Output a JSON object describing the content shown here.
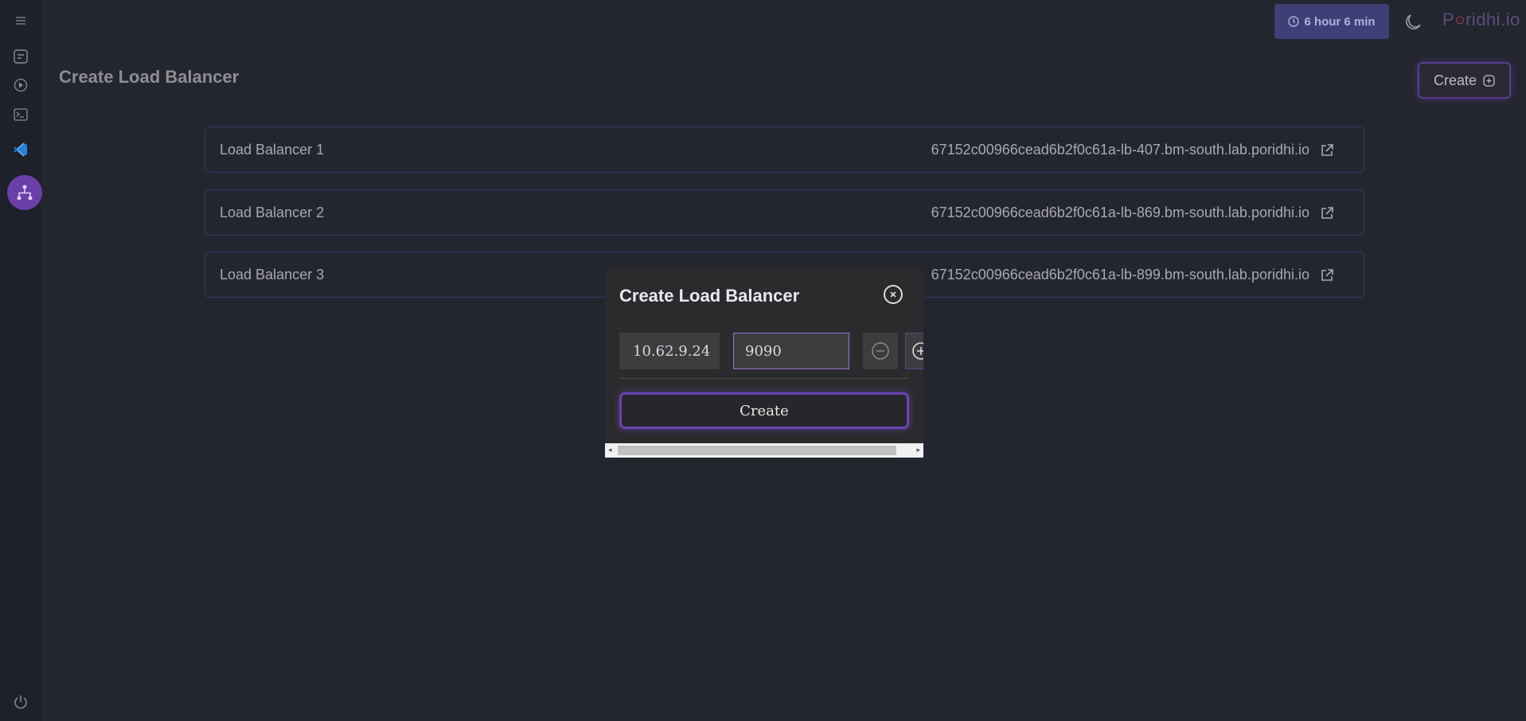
{
  "topbar": {
    "timer_label": "6 hour 6 min",
    "logo_text": "Poridhi.io"
  },
  "page": {
    "title": "Create Load Balancer",
    "create_button_label": "Create"
  },
  "load_balancers": [
    {
      "name": "Load Balancer 1",
      "url": "67152c00966cead6b2f0c61a-lb-407.bm-south.lab.poridhi.io"
    },
    {
      "name": "Load Balancer 2",
      "url": "67152c00966cead6b2f0c61a-lb-869.bm-south.lab.poridhi.io"
    },
    {
      "name": "Load Balancer 3",
      "url": "67152c00966cead6b2f0c61a-lb-899.bm-south.lab.poridhi.io"
    }
  ],
  "modal": {
    "title": "Create Load Balancer",
    "ip_value": "10.62.9.24",
    "port_value": "9090",
    "create_label": "Create"
  },
  "colors": {
    "background": "#23262e",
    "sidebar": "#1e2129",
    "accent": "#6a3fa8",
    "timer_bg": "#3f3f78"
  }
}
